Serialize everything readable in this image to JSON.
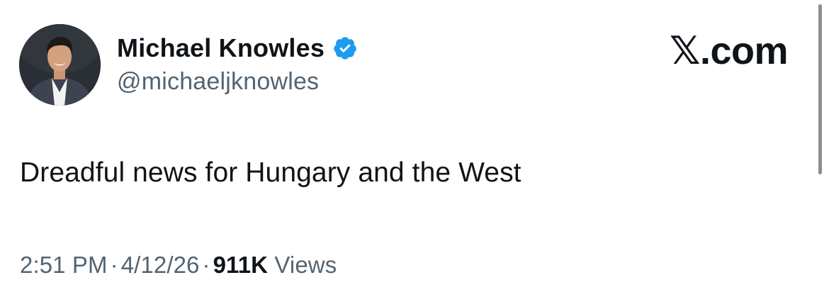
{
  "author": {
    "name": "Michael Knowles",
    "handle": "@michaeljknowles",
    "verified": true,
    "verified_badge_color": "#1d9bf0",
    "avatar_icon": "profile-photo"
  },
  "brand": {
    "label": "𝕏.com"
  },
  "tweet": {
    "text": "Dreadful news for Hungary and the West"
  },
  "meta": {
    "time": "2:51 PM",
    "separator": "·",
    "date": "4/12/26",
    "views_count": "911K",
    "views_label": "Views"
  },
  "colors": {
    "primary_text": "#0f1419",
    "secondary_text": "#536471",
    "scrollbar": "#8a8f94"
  }
}
